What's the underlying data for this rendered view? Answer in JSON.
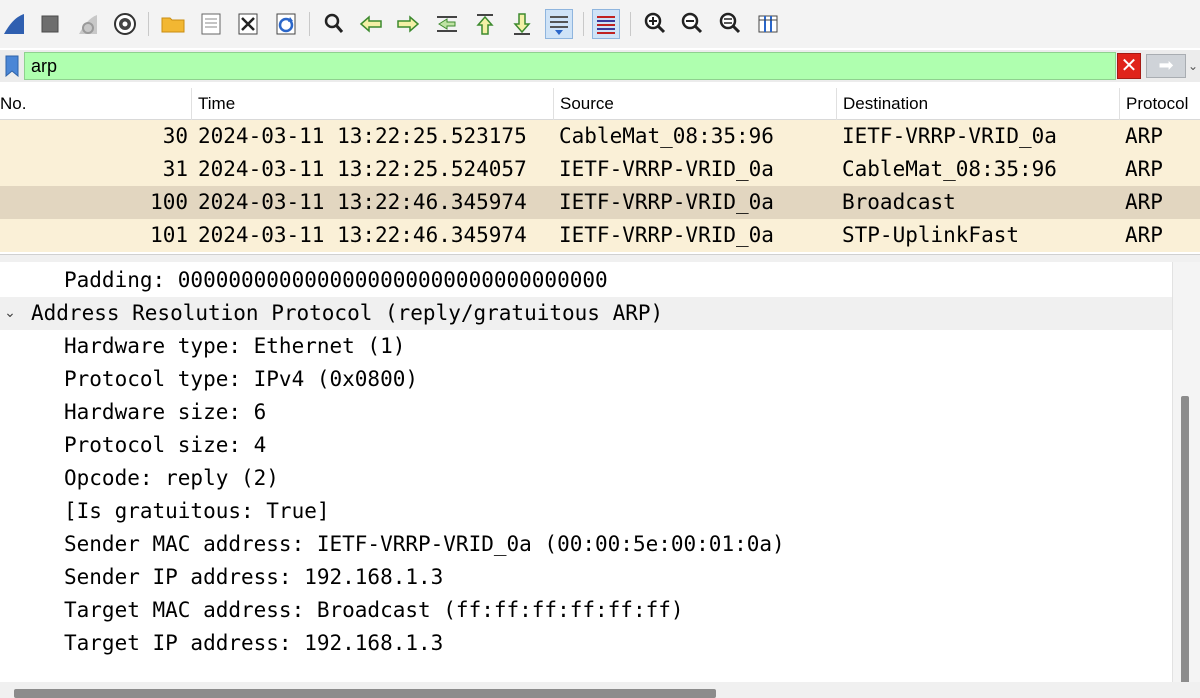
{
  "toolbar": {
    "buttons": [
      {
        "icon": "shark-fin-start-icon"
      },
      {
        "icon": "stop-capture-icon"
      },
      {
        "icon": "restart-capture-icon"
      },
      {
        "icon": "capture-options-gear-icon"
      },
      {
        "icon": "open-folder-icon"
      },
      {
        "icon": "save-file-icon"
      },
      {
        "icon": "close-file-icon"
      },
      {
        "icon": "reload-file-icon"
      },
      {
        "icon": "find-packet-icon"
      },
      {
        "icon": "go-back-icon"
      },
      {
        "icon": "go-forward-icon"
      },
      {
        "icon": "go-to-packet-icon"
      },
      {
        "icon": "go-first-packet-icon"
      },
      {
        "icon": "go-last-packet-icon"
      },
      {
        "icon": "auto-scroll-icon"
      },
      {
        "icon": "colorize-icon"
      },
      {
        "icon": "zoom-in-icon"
      },
      {
        "icon": "zoom-out-icon"
      },
      {
        "icon": "normal-size-icon"
      },
      {
        "icon": "resize-columns-icon"
      }
    ]
  },
  "filter": {
    "value": "arp",
    "background": "#afffaf",
    "clear_glyph": "✕",
    "apply_glyph": "➡",
    "dropdown_glyph": "⌄"
  },
  "packet_list": {
    "columns": [
      "No.",
      "Time",
      "Source",
      "Destination",
      "Protocol"
    ],
    "rows": [
      {
        "no": "30",
        "time": "2024-03-11 13:22:25.523175",
        "source": "CableMat_08:35:96",
        "destination": "IETF-VRRP-VRID_0a",
        "protocol": "ARP",
        "bg": "#faf0d7"
      },
      {
        "no": "31",
        "time": "2024-03-11 13:22:25.524057",
        "source": "IETF-VRRP-VRID_0a",
        "destination": "CableMat_08:35:96",
        "protocol": "ARP",
        "bg": "#faf0d7"
      },
      {
        "no": "100",
        "time": "2024-03-11 13:22:46.345974",
        "source": "IETF-VRRP-VRID_0a",
        "destination": "Broadcast",
        "protocol": "ARP",
        "bg": "#e2d6c0"
      },
      {
        "no": "101",
        "time": "2024-03-11 13:22:46.345974",
        "source": "IETF-VRRP-VRID_0a",
        "destination": "STP-UplinkFast",
        "protocol": "ARP",
        "bg": "#faf0d7"
      }
    ]
  },
  "details": {
    "chevron_glyph": "⌄",
    "lines": [
      {
        "text": "Padding: 0000000000000000000000000000000000",
        "indent": 1
      },
      {
        "text": "Address Resolution Protocol (reply/gratuitous ARP)",
        "indent": 0,
        "expanded": true
      },
      {
        "text": "Hardware type: Ethernet (1)",
        "indent": 1
      },
      {
        "text": "Protocol type: IPv4 (0x0800)",
        "indent": 1
      },
      {
        "text": "Hardware size: 6",
        "indent": 1
      },
      {
        "text": "Protocol size: 4",
        "indent": 1
      },
      {
        "text": "Opcode: reply (2)",
        "indent": 1
      },
      {
        "text": "[Is gratuitous: True]",
        "indent": 1
      },
      {
        "text": "Sender MAC address: IETF-VRRP-VRID_0a (00:00:5e:00:01:0a)",
        "indent": 1
      },
      {
        "text": "Sender IP address: 192.168.1.3",
        "indent": 1
      },
      {
        "text": "Target MAC address: Broadcast (ff:ff:ff:ff:ff:ff)",
        "indent": 1
      },
      {
        "text": "Target IP address: 192.168.1.3",
        "indent": 1
      }
    ]
  }
}
